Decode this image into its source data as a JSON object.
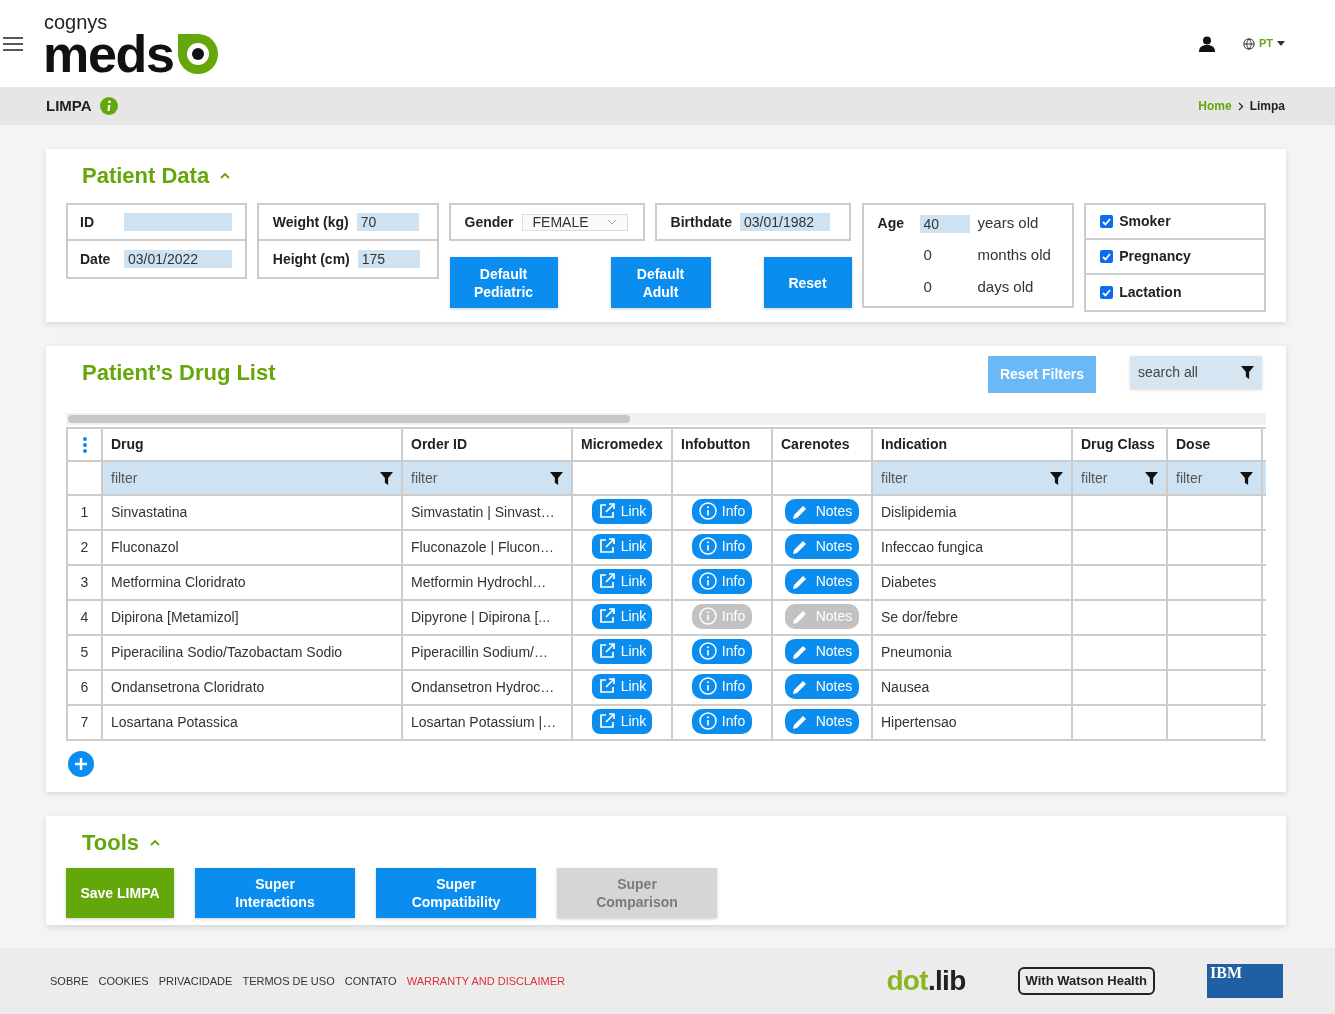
{
  "header": {
    "logo_top": "cognys",
    "logo_main": "meds",
    "language": "PT"
  },
  "breadcrumb_bar": {
    "title": "LIMPA",
    "crumbs": [
      {
        "label": "Home",
        "link": true
      },
      {
        "label": "Limpa",
        "link": false
      }
    ]
  },
  "patient_data": {
    "title": "Patient Data",
    "expanded": true,
    "id": {
      "label": "ID"
    },
    "date": {
      "label": "Date",
      "value": "03/01/2022"
    },
    "weight": {
      "label": "Weight (kg)",
      "value": "70"
    },
    "height": {
      "label": "Height (cm)",
      "value": "175"
    },
    "gender": {
      "label": "Gender",
      "value": "FEMALE"
    },
    "birthdate": {
      "label": "Birthdate",
      "value": "03/01/1982"
    },
    "age": {
      "label": "Age",
      "years": "40",
      "years_unit": "years old",
      "months": "0",
      "months_unit": "months old",
      "days": "0",
      "days_unit": "days old"
    },
    "buttons": [
      "Default Pediatric",
      "Default Adult",
      "Reset"
    ],
    "flags": [
      {
        "label": "Smoker",
        "checked": true
      },
      {
        "label": "Pregnancy",
        "checked": true
      },
      {
        "label": "Lactation",
        "checked": true
      }
    ]
  },
  "drug_list": {
    "title": "Patient’s Drug List",
    "reset_button": "Reset Filters",
    "search": {
      "placeholder": "search all"
    },
    "columns": [
      {
        "label": "Drug",
        "filter": "filter"
      },
      {
        "label": "Order ID",
        "filter": "filter"
      },
      {
        "label": "Micromedex"
      },
      {
        "label": "Infobutton"
      },
      {
        "label": "Carenotes"
      },
      {
        "label": "Indication",
        "filter": "filter"
      },
      {
        "label": "Drug Class",
        "filter": "filter"
      },
      {
        "label": "Dose",
        "filter": "filter"
      }
    ],
    "rows": [
      {
        "index": "1",
        "drug": "Sinvastatina",
        "order_id": "Simvastatin | Sinvast…",
        "link": "Link",
        "info": "Info",
        "info_disabled": false,
        "notes": "Notes",
        "notes_disabled": false,
        "indication": "Dislipidemia"
      },
      {
        "index": "2",
        "drug": "Fluconazol",
        "order_id": "Fluconazole | Flucon…",
        "link": "Link",
        "info": "Info",
        "info_disabled": false,
        "notes": "Notes",
        "notes_disabled": false,
        "indication": "Infeccao fungica"
      },
      {
        "index": "3",
        "drug": "Metformina Cloridrato",
        "order_id": "Metformin Hydrochl…",
        "link": "Link",
        "info": "Info",
        "info_disabled": false,
        "notes": "Notes",
        "notes_disabled": false,
        "indication": "Diabetes"
      },
      {
        "index": "4",
        "drug": "Dipirona [Metamizol]",
        "order_id": "Dipyrone | Dipirona [...",
        "link": "Link",
        "info": "Info",
        "info_disabled": true,
        "notes": "Notes",
        "notes_disabled": true,
        "indication": "Se dor/febre"
      },
      {
        "index": "5",
        "drug": "Piperacilina Sodio/Tazobactam Sodio",
        "order_id": "Piperacillin Sodium/…",
        "link": "Link",
        "info": "Info",
        "info_disabled": false,
        "notes": "Notes",
        "notes_disabled": false,
        "indication": "Pneumonia"
      },
      {
        "index": "6",
        "drug": "Ondansetrona Cloridrato",
        "order_id": "Ondansetron Hydroc…",
        "link": "Link",
        "info": "Info",
        "info_disabled": false,
        "notes": "Notes",
        "notes_disabled": false,
        "indication": "Nausea"
      },
      {
        "index": "7",
        "drug": "Losartana Potassica",
        "order_id": "Losartan Potassium |…",
        "link": "Link",
        "info": "Info",
        "info_disabled": false,
        "notes": "Notes",
        "notes_disabled": false,
        "indication": "Hipertensao"
      }
    ]
  },
  "tools": {
    "title": "Tools",
    "expanded": true,
    "buttons": [
      {
        "label": "Save LIMPA",
        "kind": "save",
        "disabled": false
      },
      {
        "label": "Super Interactions",
        "kind": "tool",
        "disabled": false
      },
      {
        "label": "Super Compatibility",
        "kind": "tool",
        "disabled": false
      },
      {
        "label": "Super Comparison",
        "kind": "tool",
        "disabled": true
      }
    ]
  },
  "footer": {
    "links": [
      {
        "label": "SOBRE",
        "warning": false
      },
      {
        "label": "COOKIES",
        "warning": false
      },
      {
        "label": "PRIVACIDADE",
        "warning": false
      },
      {
        "label": "TERMOS DE USO",
        "warning": false
      },
      {
        "label": "CONTATO",
        "warning": false
      },
      {
        "label": "WARRANTY AND DISCLAIMER",
        "warning": true
      }
    ],
    "partners": {
      "dotlib_a": "dot",
      "dotlib_b": ".lib",
      "watson": "With Watson Health",
      "ibm": "IBM"
    }
  }
}
